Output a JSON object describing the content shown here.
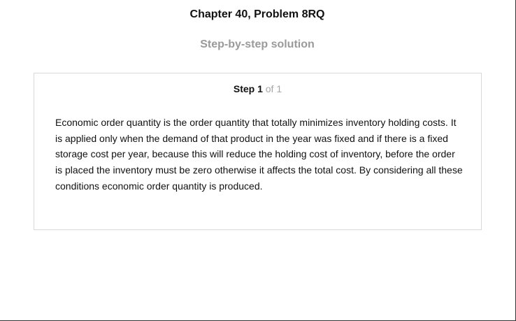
{
  "header": {
    "title": "Chapter 40, Problem 8RQ",
    "subtitle": "Step-by-step solution"
  },
  "step": {
    "label": "Step 1",
    "of_text": "of 1",
    "body": "Economic order quantity is the order quantity that totally minimizes inventory holding costs. It is applied only when the demand of that product in the year was fixed and if there is a fixed storage cost per year, because this will reduce the holding cost of inventory, before the order is placed the inventory must be zero otherwise it affects the total cost. By considering all these conditions economic order quantity is produced."
  }
}
